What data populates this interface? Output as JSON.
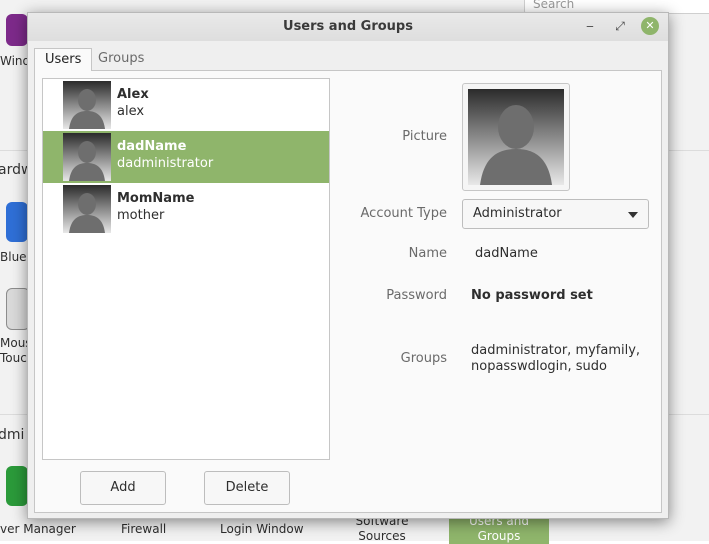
{
  "background": {
    "search_placeholder": "Search",
    "heading_hardware": "ardw",
    "heading_admin": "dmi",
    "labels": {
      "wind": "Wind",
      "blue": "Blue",
      "mous": "Mous",
      "touc": "Touc",
      "driver_manager": "ver Manager",
      "firewall": "Firewall",
      "login_window": "Login Window",
      "software_sources_1": "Software",
      "software_sources_2": "Sources",
      "users_groups_1": "Users and",
      "users_groups_2": "Groups"
    }
  },
  "dialog": {
    "title": "Users and Groups",
    "window_controls": {
      "minimize": "‒",
      "maximize": "⤢",
      "close": "✕"
    },
    "tabs": [
      {
        "label": "Users",
        "active": true
      },
      {
        "label": "Groups",
        "active": false
      }
    ],
    "users": [
      {
        "name": "Alex",
        "login": "alex",
        "selected": false
      },
      {
        "name": "dadName",
        "login": "dadministrator",
        "selected": true
      },
      {
        "name": "MomName",
        "login": "mother",
        "selected": false
      }
    ],
    "buttons": {
      "add": "Add",
      "delete": "Delete"
    },
    "details": {
      "picture_label": "Picture",
      "account_type_label": "Account Type",
      "account_type_value": "Administrator",
      "name_label": "Name",
      "name_value": "dadName",
      "password_label": "Password",
      "password_value": "No password set",
      "groups_label": "Groups",
      "groups_line1": "dadministrator, myfamily,",
      "groups_line2": "nopasswdlogin, sudo"
    }
  },
  "colors": {
    "selection": "#8fb56b",
    "close_button": "#8fb56b"
  },
  "icons": {
    "avatar": "default-user-avatar-icon",
    "dropdown": "chevron-down-icon"
  }
}
